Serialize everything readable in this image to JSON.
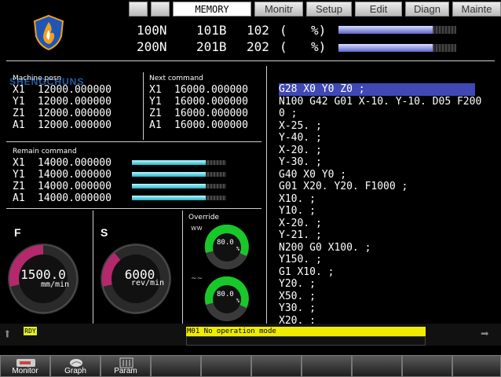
{
  "top_tabs": {
    "mode": "MEMORY",
    "tabs": [
      "Monitr",
      "Setup",
      "Edit",
      "Diagn",
      "Mainte"
    ]
  },
  "logo": {
    "text": "SHENGCHUNS"
  },
  "spindle_rows": [
    {
      "n": "100N",
      "b": "101B",
      "num": "102",
      "paren": "(",
      "pct": "%)",
      "level": 0.92
    },
    {
      "n": "200N",
      "b": "201B",
      "num": "202",
      "paren": "(",
      "pct": "%)",
      "level": 0.92
    }
  ],
  "machine_pos": {
    "title": "Machine posn",
    "rows": [
      {
        "axis": "X1",
        "value": "12000.000000"
      },
      {
        "axis": "Y1",
        "value": "12000.000000"
      },
      {
        "axis": "Z1",
        "value": "12000.000000"
      },
      {
        "axis": "A1",
        "value": "12000.000000"
      }
    ]
  },
  "next_command": {
    "title": "Next command",
    "rows": [
      {
        "axis": "X1",
        "value": "16000.000000"
      },
      {
        "axis": "Y1",
        "value": "16000.000000"
      },
      {
        "axis": "Z1",
        "value": "16000.000000"
      },
      {
        "axis": "A1",
        "value": "16000.000000"
      }
    ]
  },
  "remain_command": {
    "title": "Remain command",
    "rows": [
      {
        "axis": "X1",
        "value": "14000.000000",
        "level": 0.78
      },
      {
        "axis": "Y1",
        "value": "14000.000000",
        "level": 0.78
      },
      {
        "axis": "Z1",
        "value": "14000.000000",
        "level": 0.78
      },
      {
        "axis": "A1",
        "value": "14000.000000",
        "level": 0.78
      }
    ]
  },
  "feed": {
    "label": "F",
    "value": "1500.0",
    "unit": "mm/min"
  },
  "spindle": {
    "label": "S",
    "value": "6000",
    "unit": "rev/min"
  },
  "override": {
    "title": "Override",
    "rapid_icon": "ww",
    "feed_icon": "~~",
    "values": [
      {
        "value": "80.0",
        "unit": "%"
      },
      {
        "value": "80.0",
        "unit": "%"
      }
    ]
  },
  "program_lines": [
    "G28 X0 Y0 Z0 ;",
    "N100 G42 G01 X-10. Y-10. D05 F200",
    "0 ;",
    "X-25. ;",
    "Y-40. ;",
    "X-20. ;",
    "Y-30. ;",
    "G40 X0 Y0 ;",
    "G01 X20. Y20. F1000 ;",
    "X10. ;",
    "Y10. ;",
    "X-20. ;",
    "Y-21. ;",
    "N200 G0 X100. ;",
    "Y150. ;",
    "G1 X10. ;",
    "Y20. ;",
    "X50. ;",
    "Y30. ;",
    "X20. ;"
  ],
  "status": {
    "ready": "RDY",
    "message": "M01 No operation mode"
  },
  "function_keys": [
    {
      "label": "Monitor",
      "icon": "monitor-icon"
    },
    {
      "label": "Graph",
      "icon": "graph-icon"
    },
    {
      "label": "Param",
      "icon": "param-icon"
    }
  ],
  "colors": {
    "highlight": "#3f48b5",
    "gauge_pink": "#d4257a",
    "gauge_green": "#22cc33",
    "bar_cyan": "#20b5c9",
    "message_yellow": "#f0ec00"
  }
}
